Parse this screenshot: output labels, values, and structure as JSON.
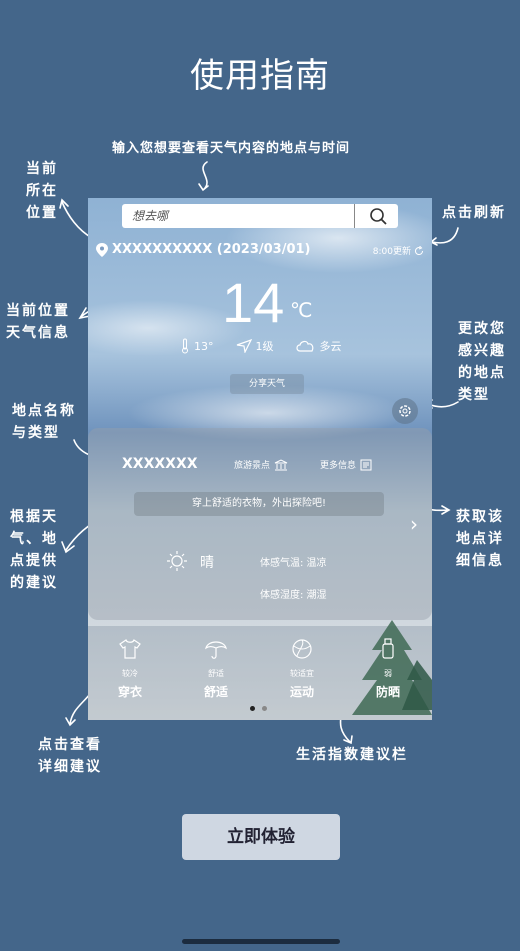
{
  "header": {
    "title": "使用指南"
  },
  "annotations": {
    "search_hint": "输入您想要查看天气内容的地点与时间",
    "current_location": "当前\n所在\n位置",
    "refresh": "点击刷新",
    "current_weather": "当前位置\n天气信息",
    "change_type": "更改您\n感兴趣\n的地点\n类型",
    "place_name_type": "地点名称\n与类型",
    "get_details": "获取该\n地点详\n细信息",
    "suggestion": "根据天\n气、地\n点提供\n的建议",
    "tap_details": "点击查看\n详细建议",
    "life_index": "生活指数建议栏"
  },
  "phone": {
    "search_placeholder": "想去哪",
    "location": "XXXXXXXXXX (2023/03/01)",
    "refresh_time": "8:00更新",
    "temperature": "14",
    "unit": "℃",
    "stats": {
      "temp_range": "13°",
      "wind": "1级",
      "sky": "多云"
    },
    "share": "分享天气",
    "place_name": "XXXXXXX",
    "place_type": "旅游景点",
    "more_info": "更多信息",
    "suggestion": "穿上舒适的衣物，外出探险吧!",
    "condition": "晴",
    "feel_temp": "体感气温: 温凉",
    "feel_humidity": "体感湿度: 潮湿",
    "life_items": [
      {
        "sub": "较冷",
        "main": "穿衣"
      },
      {
        "sub": "舒适",
        "main": "舒适"
      },
      {
        "sub": "较适宜",
        "main": "运动"
      },
      {
        "sub": "弱",
        "main": "防晒"
      }
    ]
  },
  "cta": {
    "label": "立即体验"
  },
  "icons": [
    "location-pin-icon",
    "search-icon",
    "refresh-icon",
    "thermometer-icon",
    "wind-icon",
    "cloud-icon",
    "gear-icon",
    "landmark-icon",
    "info-icon",
    "chevron-right-icon",
    "sun-icon",
    "shirt-icon",
    "umbrella-icon",
    "ball-icon",
    "sunscreen-icon"
  ]
}
